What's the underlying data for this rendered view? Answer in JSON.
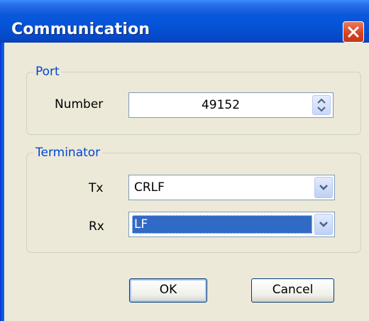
{
  "window": {
    "title": "Communication",
    "close_icon": "close-icon"
  },
  "port": {
    "legend": "Port",
    "number_label": "Number",
    "number_value": "49152"
  },
  "terminator": {
    "legend": "Terminator",
    "tx_label": "Tx",
    "tx_value": "CRLF",
    "rx_label": "Rx",
    "rx_value": "LF"
  },
  "buttons": {
    "ok_label": "OK",
    "cancel_label": "Cancel"
  },
  "colors": {
    "titlebar": "#0553D6",
    "selection": "#316AC5",
    "legend_text": "#0046D5",
    "dialog_bg": "#ECE9D8"
  }
}
